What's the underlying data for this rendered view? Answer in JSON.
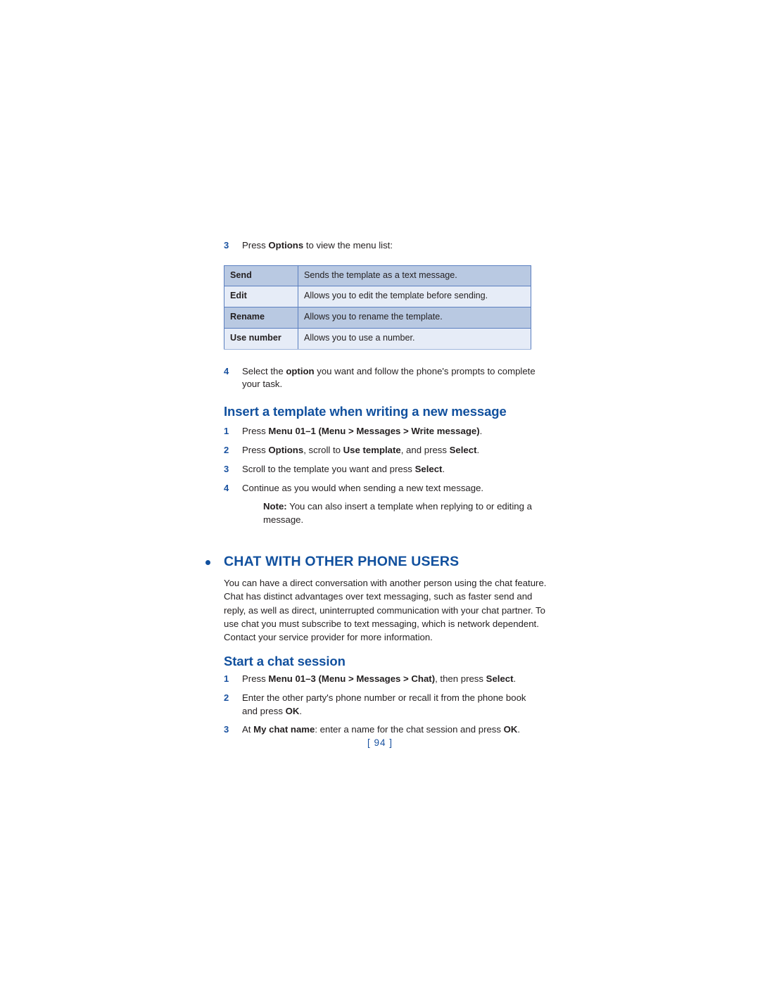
{
  "page": {
    "number_label": "[ 94 ]"
  },
  "steps_top": [
    {
      "num": "3",
      "parts": [
        {
          "t": "Press ",
          "b": false
        },
        {
          "t": "Options",
          "b": true
        },
        {
          "t": " to view the menu list:",
          "b": false
        }
      ]
    }
  ],
  "options_table": {
    "rows": [
      {
        "key": "Send",
        "value": "Sends the template as a text message.",
        "shade": "dark"
      },
      {
        "key": "Edit",
        "value": "Allows you to edit the template before sending.",
        "shade": "light"
      },
      {
        "key": "Rename",
        "value": "Allows you to rename the template.",
        "shade": "dark"
      },
      {
        "key": "Use number",
        "value": "Allows you to use a number.",
        "shade": "light"
      }
    ]
  },
  "steps_after_table": [
    {
      "num": "4",
      "parts": [
        {
          "t": "Select the ",
          "b": false
        },
        {
          "t": "option",
          "b": true
        },
        {
          "t": " you want and follow the phone's prompts to complete your task.",
          "b": false
        }
      ]
    }
  ],
  "section_insert_template": {
    "heading": "Insert a template when writing a new message",
    "steps": [
      {
        "num": "1",
        "parts": [
          {
            "t": "Press ",
            "b": false
          },
          {
            "t": "Menu 01–1 (Menu > Messages > Write message)",
            "b": true
          },
          {
            "t": ".",
            "b": false
          }
        ]
      },
      {
        "num": "2",
        "parts": [
          {
            "t": "Press ",
            "b": false
          },
          {
            "t": "Options",
            "b": true
          },
          {
            "t": ", scroll to ",
            "b": false
          },
          {
            "t": "Use template",
            "b": true
          },
          {
            "t": ", and press ",
            "b": false
          },
          {
            "t": "Select",
            "b": true
          },
          {
            "t": ".",
            "b": false
          }
        ]
      },
      {
        "num": "3",
        "parts": [
          {
            "t": "Scroll to the template you want and press ",
            "b": false
          },
          {
            "t": "Select",
            "b": true
          },
          {
            "t": ".",
            "b": false
          }
        ]
      },
      {
        "num": "4",
        "parts": [
          {
            "t": "Continue as you would when sending a new text message.",
            "b": false
          }
        ]
      }
    ],
    "note": {
      "label": "Note:",
      "text": "You can also insert a template when replying to or editing a message."
    }
  },
  "section_chat": {
    "heading": "CHAT WITH OTHER PHONE USERS",
    "bullet_icon": "filled-circle-bullet",
    "paragraph": "You can have a direct conversation with another person using the chat feature. Chat has distinct advantages over text messaging, such as faster send and reply, as well as direct, uninterrupted communication with your chat partner. To use chat you must subscribe to text messaging, which is network dependent. Contact your service provider for more information.",
    "subsection": {
      "heading": "Start a chat session",
      "steps": [
        {
          "num": "1",
          "parts": [
            {
              "t": "Press ",
              "b": false
            },
            {
              "t": "Menu 01–3 (Menu > Messages > Chat)",
              "b": true
            },
            {
              "t": ", then press ",
              "b": false
            },
            {
              "t": "Select",
              "b": true
            },
            {
              "t": ".",
              "b": false
            }
          ]
        },
        {
          "num": "2",
          "parts": [
            {
              "t": "Enter the other party's phone number or recall it from the phone book and press ",
              "b": false
            },
            {
              "t": "OK",
              "b": true
            },
            {
              "t": ".",
              "b": false
            }
          ]
        },
        {
          "num": "3",
          "parts": [
            {
              "t": "At ",
              "b": false
            },
            {
              "t": "My chat name",
              "b": true
            },
            {
              "t": ": enter a name for the chat session and press ",
              "b": false
            },
            {
              "t": "OK",
              "b": true
            },
            {
              "t": ".",
              "b": false
            }
          ]
        }
      ]
    }
  },
  "colors": {
    "heading_blue": "#11509e",
    "number_blue": "#1a52a0",
    "table_border": "#5b7fc0",
    "table_row_dark": "#b9c9e2",
    "table_row_light": "#e6ecf7",
    "body_text": "#231f20"
  }
}
